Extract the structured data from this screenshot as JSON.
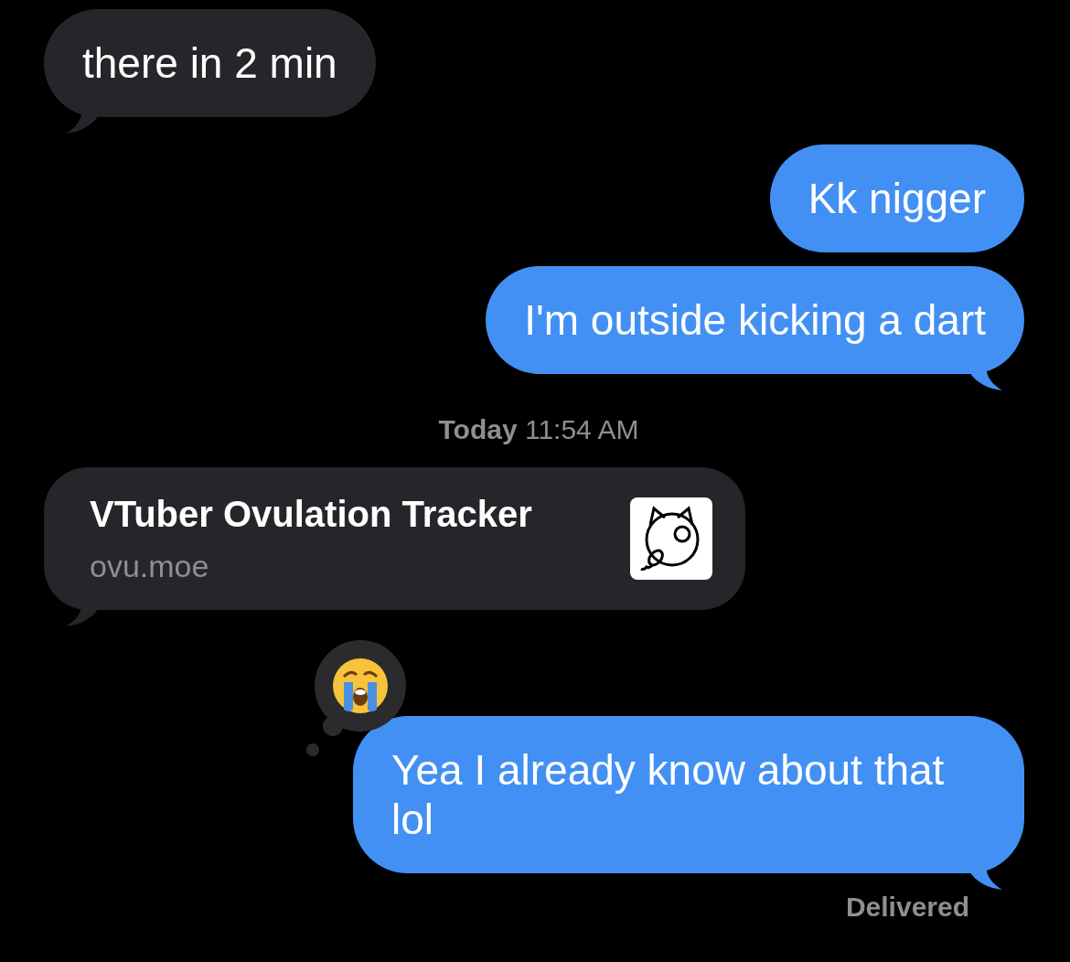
{
  "items": [
    {
      "kind": "message",
      "outgoing": false,
      "text": "there in 2 min",
      "tail": true,
      "reaction": false
    },
    {
      "kind": "message",
      "outgoing": true,
      "text": "Kk nigger",
      "tail": false,
      "reaction": false
    },
    {
      "kind": "message",
      "outgoing": true,
      "text": "I'm outside kicking a dart",
      "tail": true,
      "reaction": false
    },
    {
      "kind": "timestamp",
      "day": "Today",
      "time": "11:54 AM"
    },
    {
      "kind": "link",
      "outgoing": false,
      "title": "VTuber Ovulation Tracker",
      "domain": "ovu.moe",
      "tail": true
    },
    {
      "kind": "message",
      "outgoing": true,
      "text": "Yea I already know about that lol",
      "tail": true,
      "reaction": true
    }
  ],
  "status": "Delivered"
}
